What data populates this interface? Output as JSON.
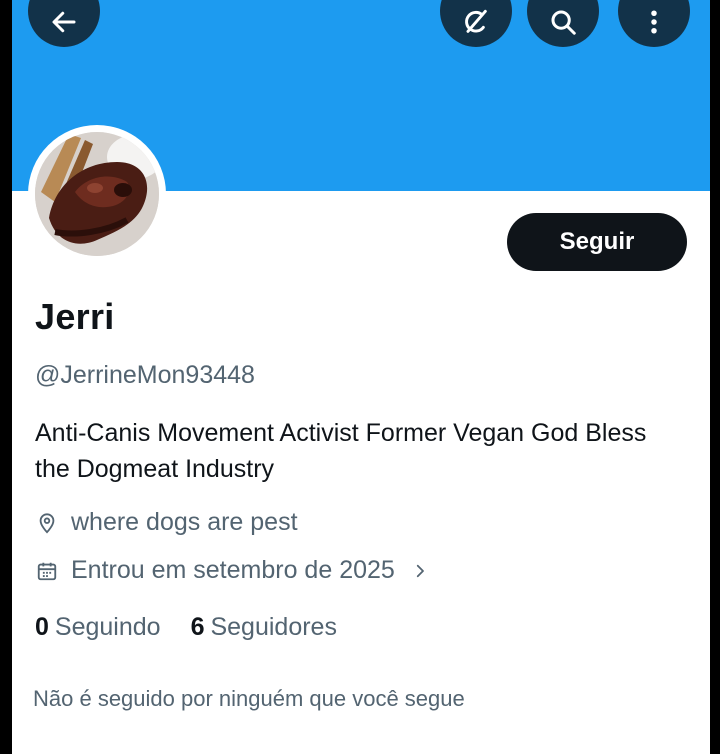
{
  "colors": {
    "banner": "#1d9bf0",
    "text_primary": "#0f1419",
    "text_secondary": "#536471",
    "button_dark": "#0f1419"
  },
  "top_bar": {
    "back_icon": "arrow-left-icon",
    "grok_icon": "grok-icon",
    "search_icon": "search-icon",
    "more_icon": "more-vertical-icon"
  },
  "profile": {
    "avatar_icon": "avatar-image",
    "follow_label": "Seguir",
    "display_name": "Jerri",
    "handle": "@JerrineMon93448",
    "bio": "Anti-Canis Movement Activist Former Vegan God Bless the Dogmeat Industry",
    "location_icon": "location-pin-icon",
    "location": "where dogs are pest",
    "joined_icon": "calendar-icon",
    "joined": "Entrou em setembro de 2025",
    "joined_chevron": "chevron-right-icon",
    "following_count": "0",
    "following_label": "Seguindo",
    "followers_count": "6",
    "followers_label": "Seguidores",
    "followed_by_note": "Não é seguido por ninguém que você segue"
  }
}
